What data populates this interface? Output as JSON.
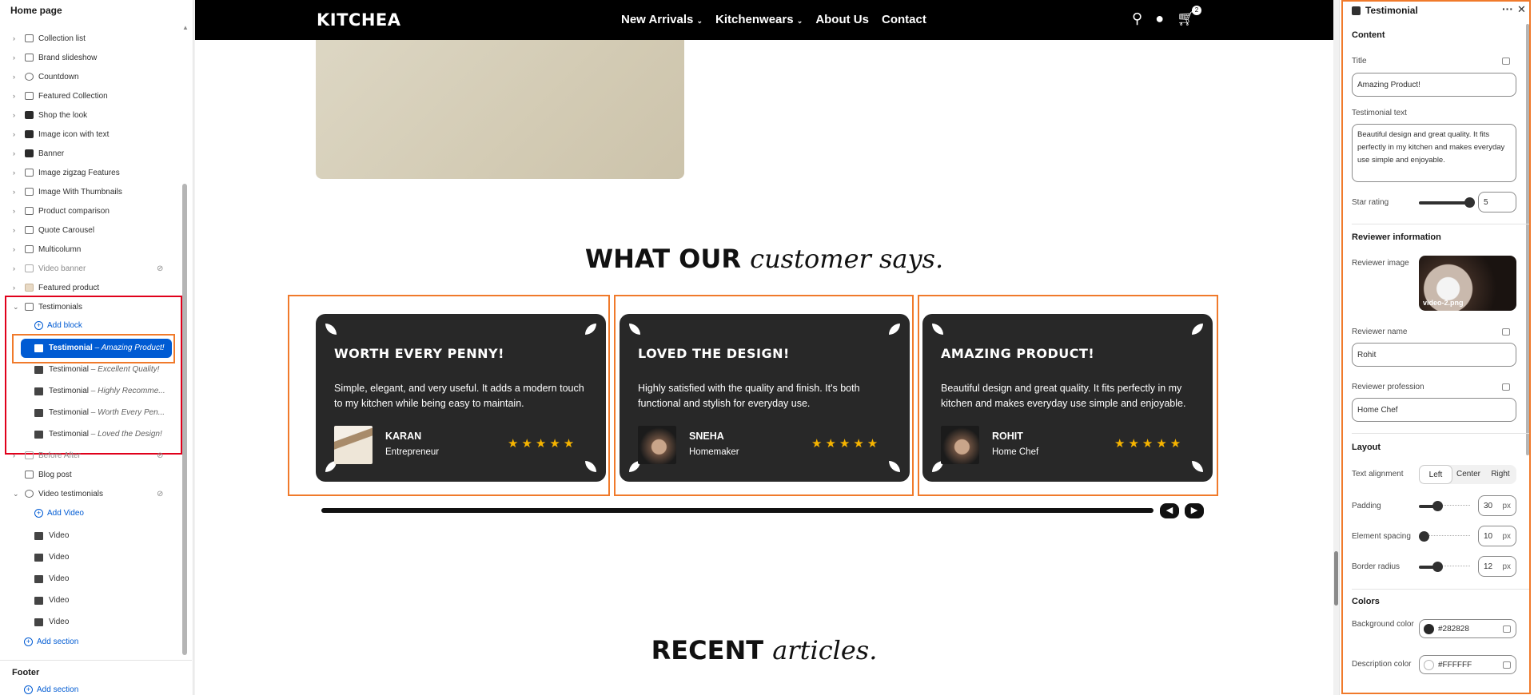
{
  "sidebar": {
    "title": "Home page",
    "sections": [
      {
        "label": "Collection list"
      },
      {
        "label": "Brand slideshow"
      },
      {
        "label": "Countdown"
      },
      {
        "label": "Featured Collection"
      },
      {
        "label": "Shop the look"
      },
      {
        "label": "Image icon with text"
      },
      {
        "label": "Banner"
      },
      {
        "label": "Image zigzag Features"
      },
      {
        "label": "Image With Thumbnails"
      },
      {
        "label": "Product comparison"
      },
      {
        "label": "Quote Carousel"
      },
      {
        "label": "Multicolumn"
      },
      {
        "label": "Video banner"
      },
      {
        "label": "Featured product"
      }
    ],
    "testimonials_label": "Testimonials",
    "add_block": "Add block",
    "blocks": [
      {
        "label": "Testimonial",
        "sub": " – Amazing Product!"
      },
      {
        "label": "Testimonial",
        "sub": " – Excellent Quality!"
      },
      {
        "label": "Testimonial",
        "sub": " – Highly Recomme..."
      },
      {
        "label": "Testimonial",
        "sub": " – Worth Every Pen..."
      },
      {
        "label": "Testimonial",
        "sub": " – Loved the Design!"
      }
    ],
    "before_after": "Before After",
    "blog_post": "Blog post",
    "video_testimonials": "Video testimonials",
    "add_video": "Add Video",
    "videos": [
      "Video",
      "Video",
      "Video",
      "Video",
      "Video"
    ],
    "add_section": "Add section",
    "footer": "Footer",
    "footer_add_section": "Add section"
  },
  "store": {
    "logo": "KITCHEA",
    "nav": [
      "New Arrivals",
      "Kitchenwears",
      "About Us",
      "Contact"
    ],
    "cart_count": "2",
    "section_title_bold": "WHAT OUR",
    "section_title_script": "customer says.",
    "recent_bold": "RECENT",
    "recent_script": "articles.",
    "cards": [
      {
        "title": "WORTH EVERY PENNY!",
        "text": "Simple, elegant, and very useful. It adds a modern touch to my kitchen while being easy to maintain.",
        "name": "KARAN",
        "job": "Entrepreneur",
        "stars": "★★★★★"
      },
      {
        "title": "LOVED THE DESIGN!",
        "text": "Highly satisfied with the quality and finish. It's both functional and stylish for everyday use.",
        "name": "SNEHA",
        "job": "Homemaker",
        "stars": "★★★★★"
      },
      {
        "title": "AMAZING PRODUCT!",
        "text": "Beautiful design and great quality. It fits perfectly in my kitchen and makes everyday use simple and enjoyable.",
        "name": "ROHIT",
        "job": "Home Chef",
        "stars": "★★★★★"
      }
    ]
  },
  "panel": {
    "title": "Testimonial",
    "content_heading": "Content",
    "title_label": "Title",
    "title_value": "Amazing Product!",
    "text_label": "Testimonial text",
    "text_value": "Beautiful design and great quality. It fits perfectly in my kitchen and makes everyday use simple and enjoyable.",
    "star_label": "Star rating",
    "star_value": "5",
    "reviewer_heading": "Reviewer information",
    "image_label": "Reviewer image",
    "image_name": "video-2.png",
    "name_label": "Reviewer name",
    "name_value": "Rohit",
    "profession_label": "Reviewer profession",
    "profession_value": "Home Chef",
    "layout_heading": "Layout",
    "align_label": "Text alignment",
    "align_options": [
      "Left",
      "Center",
      "Right"
    ],
    "padding_label": "Padding",
    "padding_value": "30",
    "spacing_label": "Element spacing",
    "spacing_value": "10",
    "radius_label": "Border radius",
    "radius_value": "12",
    "unit": "px",
    "colors_heading": "Colors",
    "bg_label": "Background color",
    "bg_value": "#282828",
    "desc_label": "Description color",
    "desc_value": "#FFFFFF"
  },
  "colors": {
    "accent": "#005bd3",
    "highlight": "#f07a2b",
    "error": "#e0001b",
    "card_bg": "#282828",
    "star": "#f6b400"
  }
}
